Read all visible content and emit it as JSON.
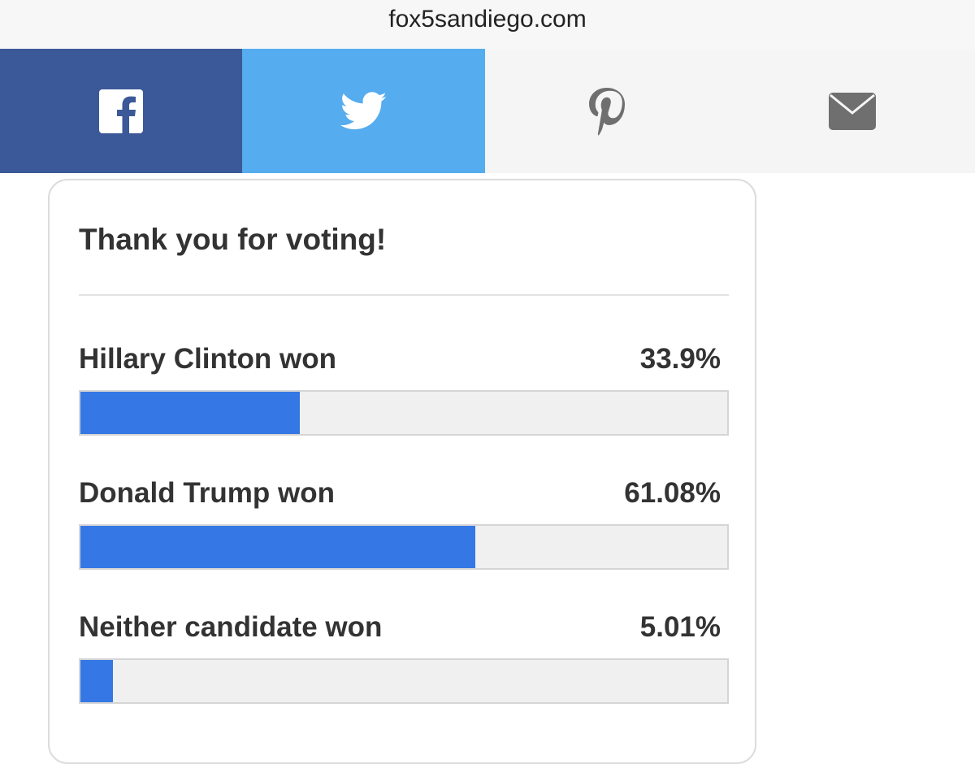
{
  "browser": {
    "url": "fox5sandiego.com"
  },
  "share": {
    "facebook": {
      "icon": "facebook-icon",
      "color": "#3b5998"
    },
    "twitter": {
      "icon": "twitter-icon",
      "color": "#55acee"
    },
    "pinterest": {
      "icon": "pinterest-icon",
      "color": "#f5f5f5"
    },
    "email": {
      "icon": "email-icon",
      "color": "#f5f5f5"
    }
  },
  "poll": {
    "title": "Thank you for voting!",
    "bar_color": "#3578e5",
    "options": [
      {
        "label": "Hillary Clinton won",
        "percent_text": "33.9%",
        "percent": 33.9
      },
      {
        "label": "Donald Trump won",
        "percent_text": "61.08%",
        "percent": 61.08
      },
      {
        "label": "Neither candidate won",
        "percent_text": "5.01%",
        "percent": 5.01
      }
    ]
  }
}
